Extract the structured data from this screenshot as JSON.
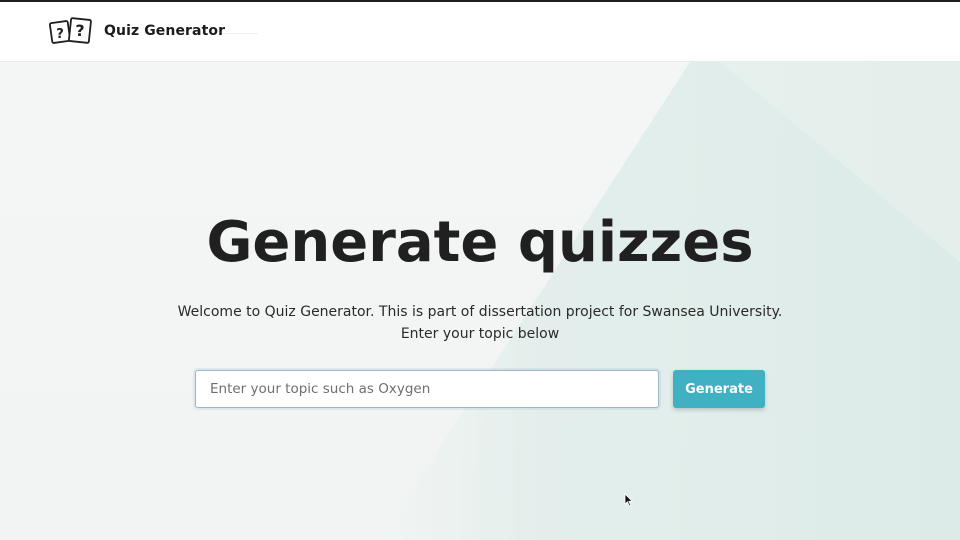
{
  "navbar": {
    "brand_name": "Quiz Generator",
    "logo_icon": "question-cards-icon"
  },
  "hero": {
    "title": "Generate quizzes",
    "subtitle_line1": "Welcome to Quiz Generator. This is part of dissertation project for Swansea University.",
    "subtitle_line2": "Enter your topic below"
  },
  "search": {
    "placeholder": "Enter your topic such as Oxygen",
    "value": ""
  },
  "actions": {
    "generate_label": "Generate"
  },
  "colors": {
    "accent": "#3fb1c2",
    "text_dark": "#202020",
    "background": "#f3f5f5"
  }
}
